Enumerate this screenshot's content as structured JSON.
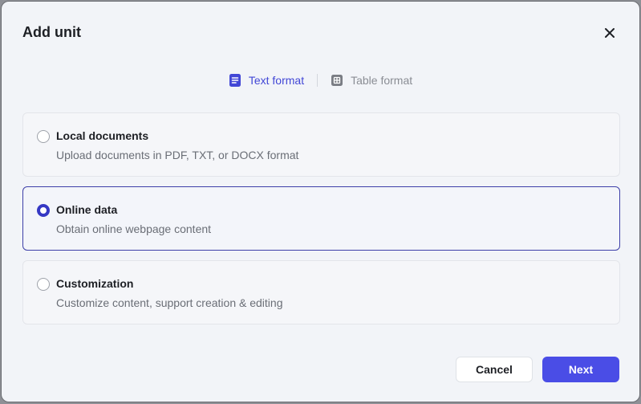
{
  "dialog": {
    "title": "Add unit",
    "close_icon": "close-icon"
  },
  "tabs": [
    {
      "label": "Text format",
      "icon": "document-icon",
      "active": true
    },
    {
      "label": "Table format",
      "icon": "table-icon",
      "active": false
    }
  ],
  "options": [
    {
      "title": "Local documents",
      "description": "Upload documents in PDF, TXT, or DOCX format",
      "selected": false
    },
    {
      "title": "Online data",
      "description": "Obtain online webpage content",
      "selected": true
    },
    {
      "title": "Customization",
      "description": "Customize content, support creation & editing",
      "selected": false
    }
  ],
  "footer": {
    "cancel_label": "Cancel",
    "next_label": "Next"
  },
  "colors": {
    "accent": "#4a4de6",
    "selected_border": "#3d3fa8",
    "tab_active": "#4247d6"
  }
}
